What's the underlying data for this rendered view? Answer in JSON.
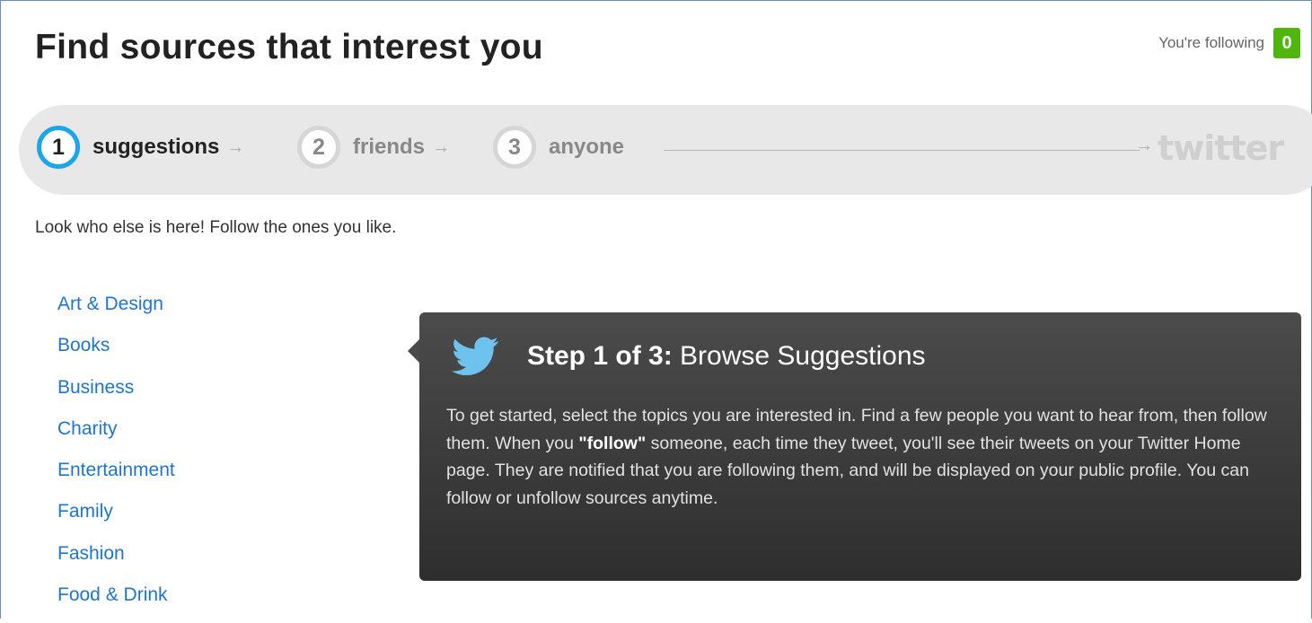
{
  "header": {
    "title": "Find sources that interest you",
    "following_label": "You're following",
    "following_count": "0"
  },
  "steps": [
    {
      "number": "1",
      "label": "suggestions",
      "active": true
    },
    {
      "number": "2",
      "label": "friends",
      "active": false
    },
    {
      "number": "3",
      "label": "anyone",
      "active": false
    }
  ],
  "brand": {
    "logo_text": "twitter",
    "accent": "#1ca5e8",
    "count_bg": "#4fb60e"
  },
  "intro_text": "Look who else is here! Follow the ones you like.",
  "topics": [
    "Art & Design",
    "Books",
    "Business",
    "Charity",
    "Entertainment",
    "Family",
    "Fashion",
    "Food & Drink"
  ],
  "tooltip": {
    "icon": "twitter-bird-icon",
    "heading_strong": "Step 1 of 3:",
    "heading_rest": "Browse Suggestions",
    "body_before": "To get started, select the topics you are interested in. Find a few people you want to hear from, then follow them. When you ",
    "body_strong": "\"follow\"",
    "body_after": " someone, each time they tweet, you'll see their tweets on your Twitter Home page. They are notified that you are following them, and will be displayed on your public profile. You can follow or unfollow sources anytime."
  }
}
